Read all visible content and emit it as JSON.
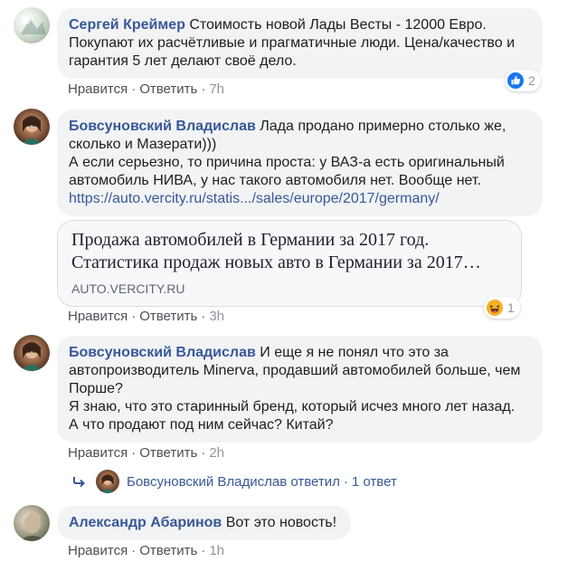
{
  "comments": [
    {
      "author": "Сергей Креймер",
      "lines": [
        "Стоимость новой Лады Весты - 12000 Евро.",
        "Покупают их расчётливые и прагматичные люди. Цена/качество и",
        "гарантия 5 лет делают своё дело."
      ],
      "like": "Нравится",
      "reply": "Ответить",
      "time": "7h",
      "reaction_icon": "like-icon",
      "reaction_count": "2"
    },
    {
      "author": "Бовсуновский Владислав",
      "lines": [
        "Лада продано примерно столько же,",
        "сколько и Мазерати)))",
        "А если серьезно, то причина проста: у ВАЗ-а есть оригинальный",
        "автомобиль НИВА, у нас такого автомобиля нет. Вообще нет."
      ],
      "link": "https://auto.vercity.ru/statis.../sales/europe/2017/germany/",
      "preview": {
        "title_line1": "Продажа автомобилей в Германии за 2017 год.",
        "title_line2": "Статистика продаж новых авто в Германии за 2017…",
        "domain": "AUTO.VERCITY.RU"
      },
      "like": "Нравится",
      "reply": "Ответить",
      "time": "3h",
      "reaction_icon": "haha-icon",
      "reaction_count": "1"
    },
    {
      "author": "Бовсуновский Владислав",
      "lines": [
        "И еще я не понял что это за",
        "автопроизводитель Minerva, продавший автомобилей больше, чем",
        "Порше?",
        "Я знаю, что это старинный бренд, который исчез много лет назад.",
        "А что продают под ним сейчас? Китай?"
      ],
      "like": "Нравится",
      "reply": "Ответить",
      "time": "2h",
      "replies_summary": {
        "author": "Бовсуновский Владислав",
        "verb": "ответил",
        "count": "1 ответ"
      }
    },
    {
      "author": "Александр Абаринов",
      "lines": [
        "Вот это новость!"
      ],
      "like": "Нравится",
      "reply": "Ответить",
      "time": "1h"
    }
  ],
  "colors": {
    "author": "#385898",
    "bubble_bg": "#f2f3f5",
    "like_blue": "#1877f2",
    "haha_yellow": "#f7b125"
  }
}
